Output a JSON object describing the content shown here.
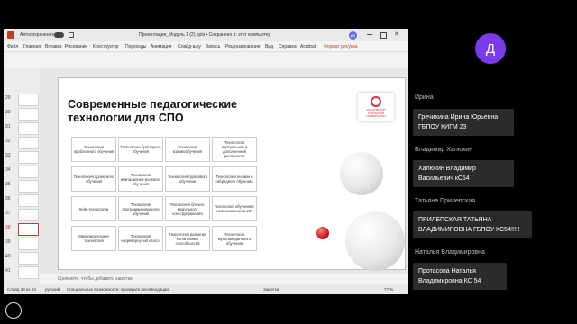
{
  "window": {
    "autosave_label": "Автосохранение",
    "doc_title": "Презентация_Модуль 1 (2).pptx • Сохранено в: этот компьютер",
    "user_initials": "ДВ"
  },
  "menu": [
    "Файл",
    "Главная",
    "Вставка",
    "Рисование",
    "Конструктор",
    "Переходы",
    "Анимация",
    "Слайд-шоу",
    "Запись",
    "Рецензирование",
    "Вид",
    "Справка",
    "Acrobat",
    "Формат рисунка"
  ],
  "thumbnails": [
    "29",
    "30",
    "31",
    "32",
    "33",
    "34",
    "35",
    "36",
    "37",
    "38",
    "39",
    "40",
    "41",
    "42",
    "43"
  ],
  "slide": {
    "title": "Современные педагогические технологии для СПО",
    "cells": [
      [
        "Технология проблемного обучения",
        "Технология бригадного обучения",
        "Технология взаимообучения",
        "Технология виртуальной и дополненной реальности"
      ],
      [
        "Технология проектного обучения",
        "Технология имитационно-ролевого обучения",
        "Технология группового обучения",
        "Технология онлайн и гибридного обучения"
      ],
      [
        "Кейс-технологии",
        "Технология программированного обучения",
        "Технология блочно-модульного конструирования",
        "Технология обучения с использованием ИИ"
      ],
      [
        "Микромодульная технология",
        "Технология «перевернутый класс»",
        "Технология развития когнитивных способностей",
        "Технология мультимодального обучения"
      ]
    ],
    "logo_text": "МОСКОВСКИЙ ГОРОДСКОЙ УНИВЕРСИТЕТ"
  },
  "notes_placeholder": "Щелкните, чтобы добавить заметки",
  "status": {
    "slide": "Слайд 38 из 53",
    "lang": "русский",
    "accessibility": "Специальные возможности: проверьте рекомендации",
    "notes": "Заметки",
    "zoom": "77 %"
  },
  "participants_panel": {
    "avatar_letter": "Д",
    "avatar_color": "#7c3aed",
    "participants": [
      {
        "name": "Ирина",
        "message": "Гречихина Ирина Юрьевна ГБПОУ КИГМ 23"
      },
      {
        "name": "Владимир Халюкин",
        "message": "Халюкин Владимир Васильевич кС54"
      },
      {
        "name": "Татьяна Прилепская",
        "message": "ПРИЛЕПСКАЯ ТАТЬЯНА ВЛАДИМИРОВНА ГБПОУ КС54!!!!!"
      },
      {
        "name": "Наталья Владимировна",
        "message": "Протасова Наталья Владимировна КС 54"
      }
    ]
  }
}
